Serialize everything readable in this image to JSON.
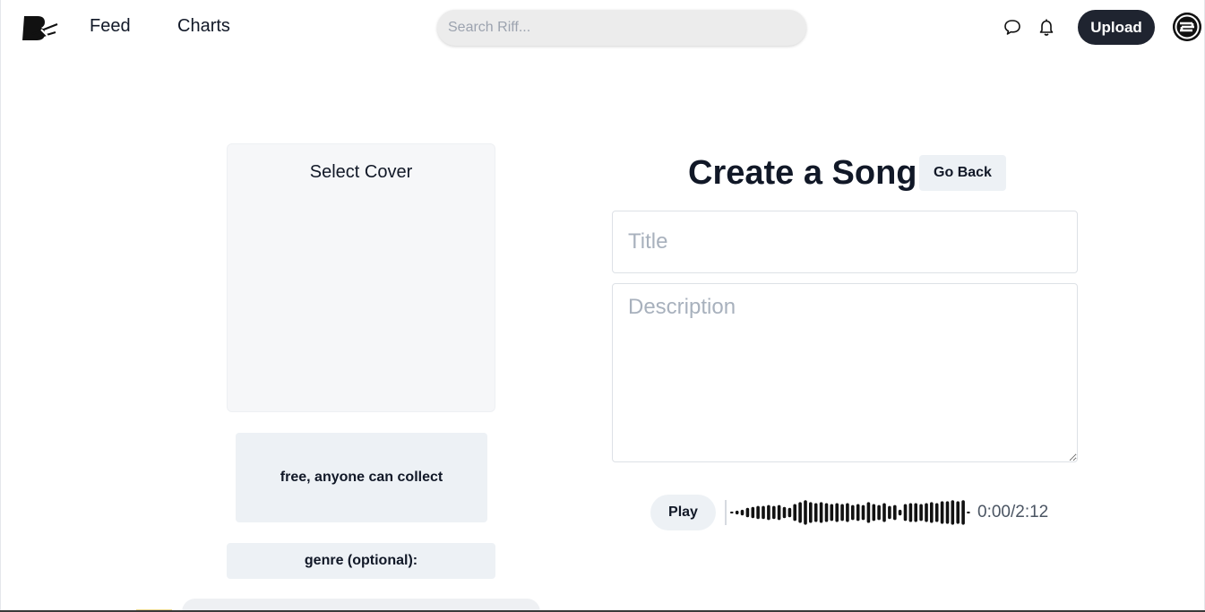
{
  "nav": {
    "logo_icon": "riff-logo-icon",
    "links": [
      {
        "label": "Feed"
      },
      {
        "label": "Charts"
      }
    ],
    "search": {
      "placeholder": "Search Riff...",
      "value": ""
    },
    "chat_icon": "chat-bubble-icon",
    "bell_icon": "bell-icon",
    "upload_label": "Upload",
    "avatar_icon": "user-avatar-icon"
  },
  "cover": {
    "label": "Select Cover"
  },
  "license": {
    "label": "free, anyone can collect"
  },
  "genre": {
    "label": "genre (optional):"
  },
  "form": {
    "heading": "Create a Song",
    "go_back_label": "Go Back",
    "title_placeholder": "Title",
    "description_placeholder": "Description"
  },
  "player": {
    "play_label": "Play",
    "time": "0:00/2:12",
    "waveform_icon": "audio-waveform-icon"
  },
  "colors": {
    "primary_dark": "#1f2430",
    "button_light": "#edf1f5",
    "search_bg": "#ececec"
  }
}
